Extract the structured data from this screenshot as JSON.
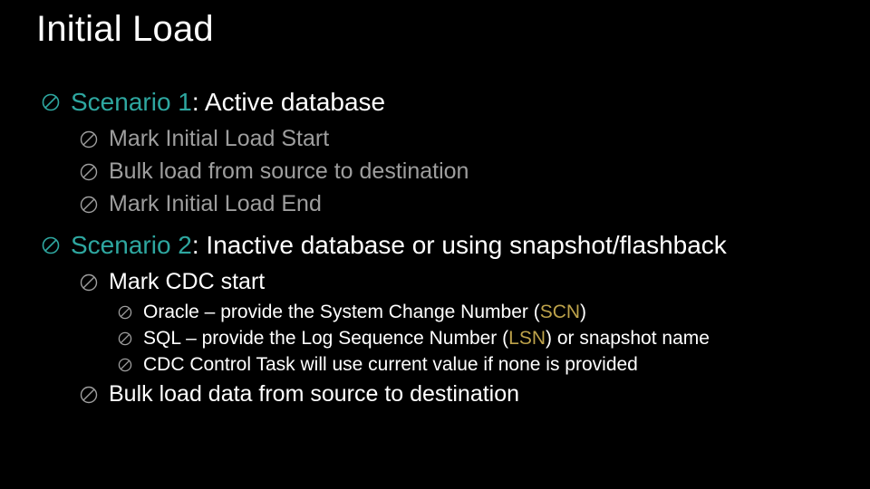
{
  "title": "Initial Load",
  "s1_label": "Scenario 1",
  "s1_rest": ": Active database",
  "s1_items": {
    "a": "Mark Initial Load Start",
    "b": "Bulk load from source to destination",
    "c": "Mark Initial Load End"
  },
  "s2_label": "Scenario 2",
  "s2_rest": ": Inactive database or using snapshot/flashback",
  "s2_mark": "Mark CDC start",
  "s2_oracle_pre": "Oracle – provide the System Change Number (",
  "s2_oracle_abbr": "SCN",
  "s2_oracle_post": ")",
  "s2_sql_pre": "SQL – provide the Log Sequence Number (",
  "s2_sql_abbr": "LSN",
  "s2_sql_post": ") or snapshot name",
  "s2_cdc": "CDC Control Task will use current value if none is provided",
  "s2_bulk": "Bulk load data from source to destination"
}
